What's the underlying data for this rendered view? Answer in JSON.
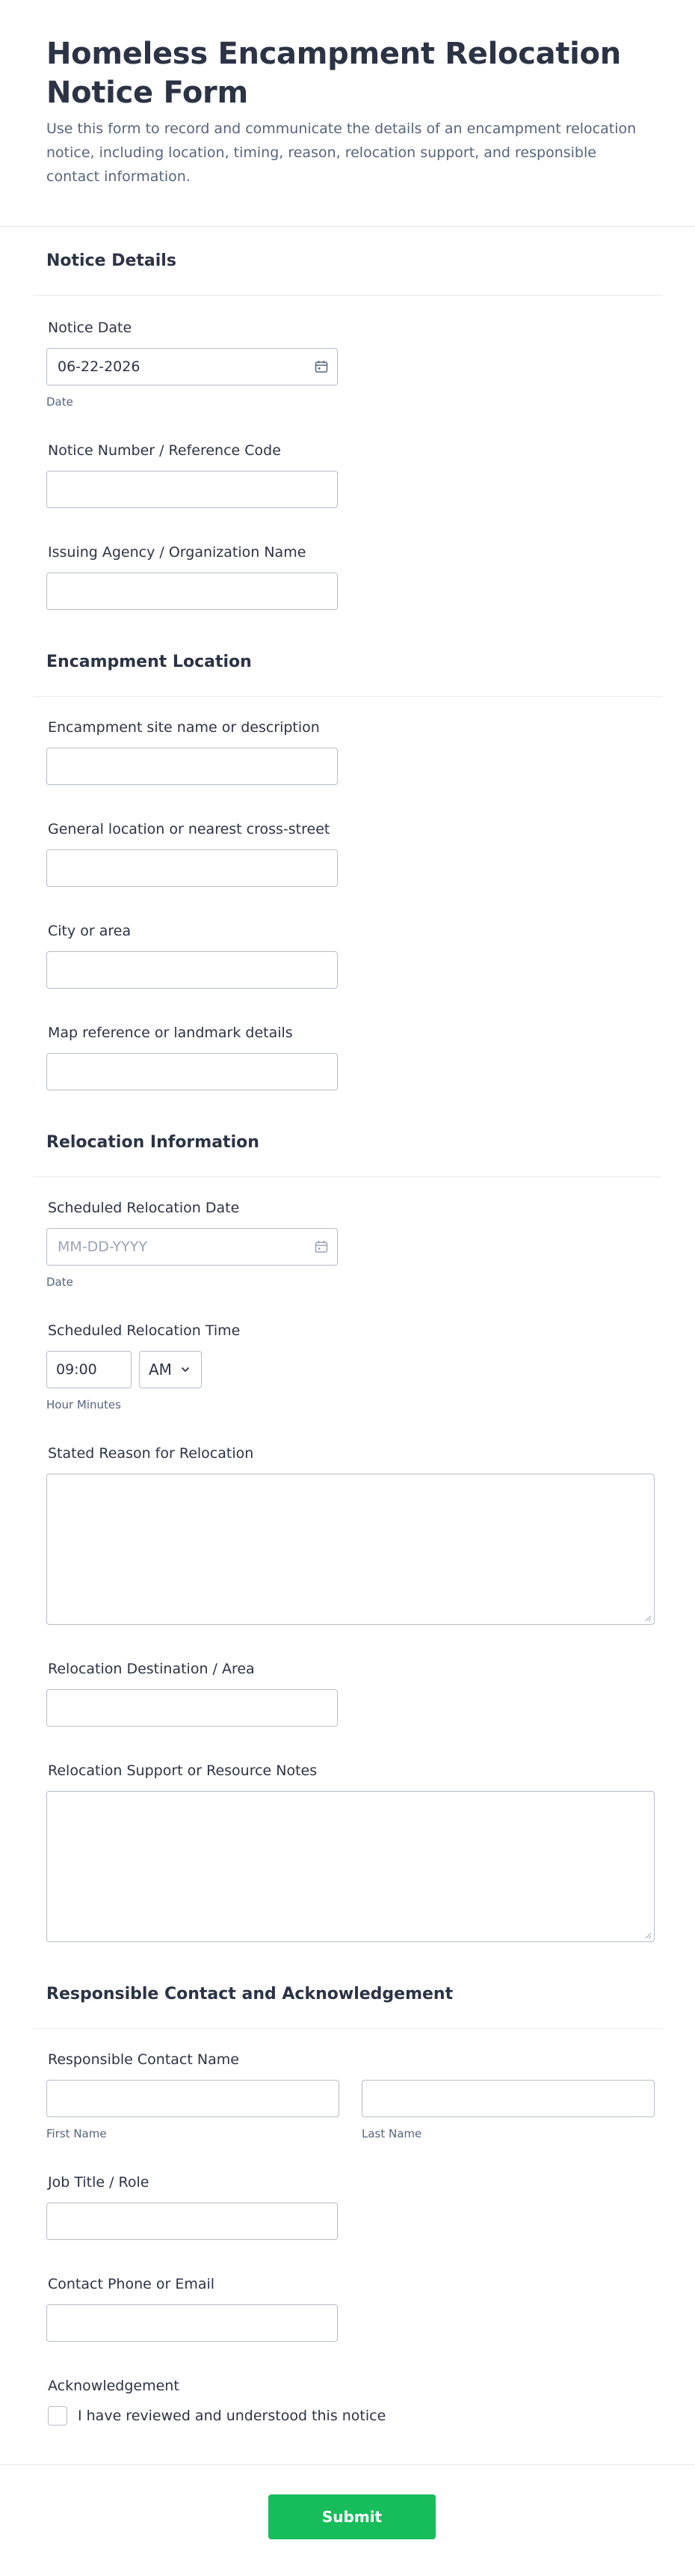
{
  "header": {
    "title": "Homeless Encampment Relocation Notice Form",
    "subtitle": "Use this form to record and communicate the details of an encampment relocation notice, including location, timing, reason, relocation support, and responsible contact information."
  },
  "sections": {
    "notice": {
      "title": "Notice Details",
      "notice_date_label": "Notice Date",
      "notice_date_value": "06-22-2026",
      "notice_date_sublabel": "Date",
      "notice_number_label": "Notice Number / Reference Code",
      "agency_label": "Issuing Agency / Organization Name"
    },
    "location": {
      "title": "Encampment Location",
      "site_label": "Encampment site name or description",
      "general_label": "General location or nearest cross-street",
      "city_label": "City or area",
      "map_label": "Map reference or landmark details"
    },
    "relocation": {
      "title": "Relocation Information",
      "date_label": "Scheduled Relocation Date",
      "date_placeholder": "MM-DD-YYYY",
      "date_sublabel": "Date",
      "time_label": "Scheduled Relocation Time",
      "time_value": "09:00",
      "ampm_value": "AM",
      "time_sublabel": "Hour Minutes",
      "reason_label": "Stated Reason for Relocation",
      "destination_label": "Relocation Destination / Area",
      "support_label": "Relocation Support or Resource Notes"
    },
    "contact": {
      "title": "Responsible Contact and Acknowledgement",
      "name_label": "Responsible Contact Name",
      "first_sublabel": "First Name",
      "last_sublabel": "Last Name",
      "job_label": "Job Title / Role",
      "phone_label": "Contact Phone or Email",
      "ack_label": "Acknowledgement",
      "ack_checkbox_label": "I have reviewed and understood this notice"
    }
  },
  "footer": {
    "submit_label": "Submit"
  },
  "colors": {
    "accent": "#18bd5b",
    "text": "#2c3345",
    "muted": "#57647e",
    "border": "#b8bdc9"
  }
}
